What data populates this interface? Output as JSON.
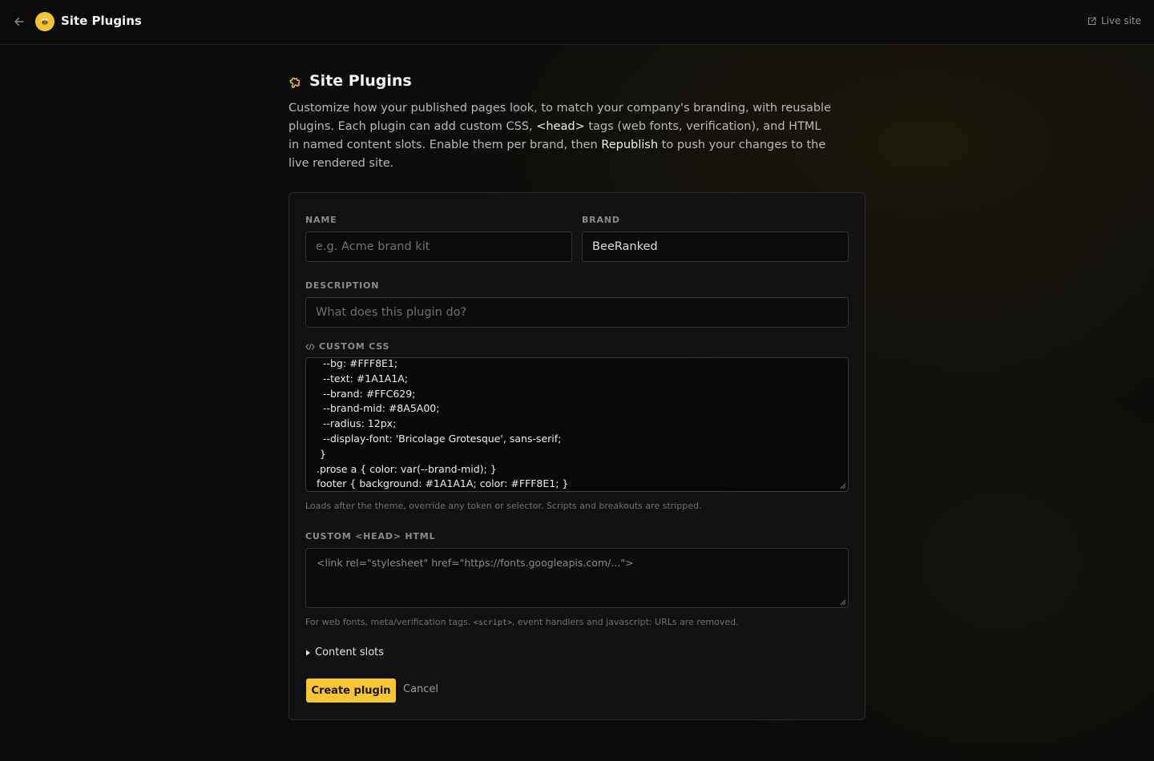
{
  "header": {
    "title": "Site Plugins",
    "live_site_label": "Live site"
  },
  "page": {
    "title": "Site Plugins",
    "intro": {
      "part1": "Customize how your published pages look, to match your company's branding, with reusable plugins. Each plugin can add custom CSS, ",
      "head_tag": "<head>",
      "part2": " tags (web fonts, verification), and HTML in named content slots. Enable them per brand, then ",
      "republish": "Republish",
      "part3": " to push your changes to the live rendered site."
    }
  },
  "form": {
    "name": {
      "label": "NAME",
      "value": "",
      "placeholder": "e.g. Acme brand kit"
    },
    "brand": {
      "label": "BRAND",
      "value": "BeeRanked"
    },
    "description": {
      "label": "DESCRIPTION",
      "value": "",
      "placeholder": "What does this plugin do?"
    },
    "custom_css": {
      "label": "CUSTOM CSS",
      "lines": [
        "  --bg: #FFF8E1;",
        "  --text: #1A1A1A;",
        "  --brand: #FFC629;",
        "  --brand-mid: #8A5A00;",
        "  --radius: 12px;",
        "  --display-font: 'Bricolage Grotesque', sans-serif;",
        " }",
        ".prose a { color: var(--brand-mid); }",
        "footer { background: #1A1A1A; color: #FFF8E1; }"
      ],
      "hint": "Loads after the theme, override any token or selector. Scripts and breakouts are stripped."
    },
    "custom_head": {
      "label": "CUSTOM <HEAD> HTML",
      "placeholder": "<link rel=\"stylesheet\" href=\"https://fonts.googleapis.com/...\">",
      "hint_part1": "For web fonts, meta/verification tags. ",
      "hint_code": "<script>",
      "hint_part2": ", event handlers and javascript: URLs are removed."
    },
    "content_slots_label": "Content slots",
    "create_label": "Create plugin",
    "cancel_label": "Cancel"
  },
  "colors": {
    "accent": "#F8C630",
    "background": "#0C0C0C"
  },
  "icons": {
    "back": "arrow-left-icon",
    "logo": "bee-icon",
    "live_site": "external-link-icon",
    "title": "puzzle-icon",
    "css": "code-icon",
    "slots": "triangle-right-icon"
  }
}
